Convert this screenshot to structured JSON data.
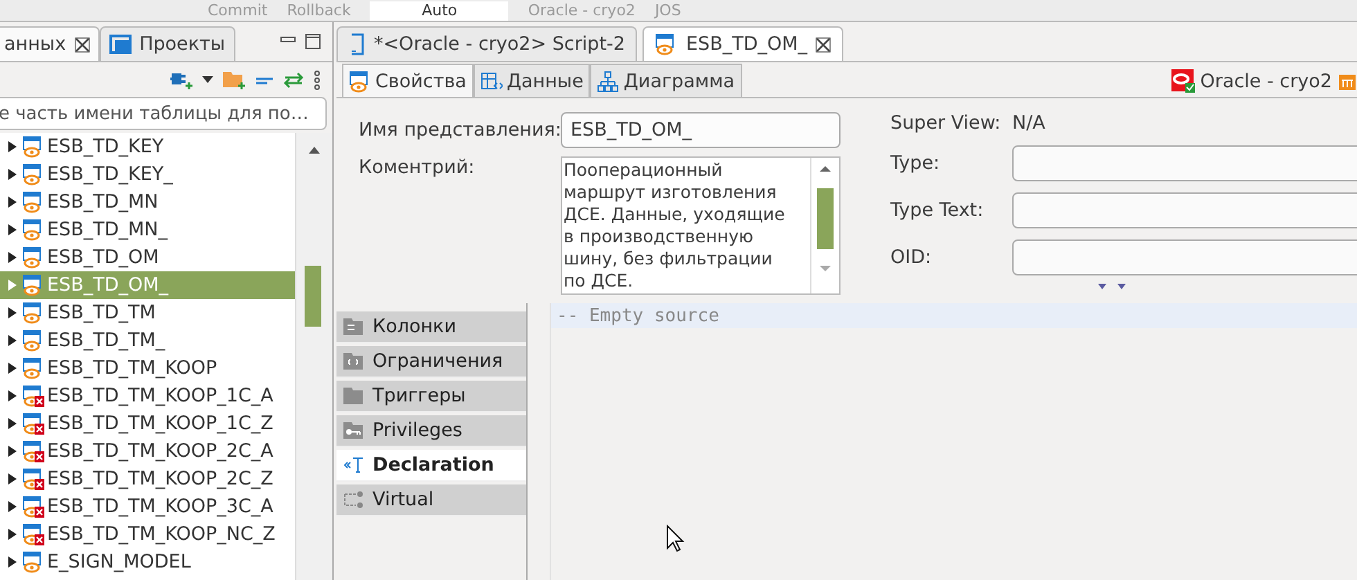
{
  "toolbar": {
    "items": [
      {
        "label": "Commit",
        "kind": "button"
      },
      {
        "label": "Rollback",
        "kind": "button"
      },
      {
        "label": "Auto",
        "kind": "combo"
      },
      {
        "label": "Oracle - cryo2",
        "kind": "button"
      },
      {
        "label": "JOS",
        "kind": "button"
      }
    ]
  },
  "left_panel": {
    "tabs": [
      {
        "label": "анных",
        "selected": true
      },
      {
        "label": "Проекты",
        "selected": false
      }
    ],
    "filter": {
      "placeholder": "е часть имени таблицы для по…"
    },
    "tree": [
      {
        "label": "ESB_TD_KEY",
        "kind": "view",
        "selected": false
      },
      {
        "label": "ESB_TD_KEY_",
        "kind": "view",
        "selected": false
      },
      {
        "label": "ESB_TD_MN",
        "kind": "view",
        "selected": false
      },
      {
        "label": "ESB_TD_MN_",
        "kind": "view",
        "selected": false
      },
      {
        "label": "ESB_TD_OM",
        "kind": "view",
        "selected": false
      },
      {
        "label": "ESB_TD_OM_",
        "kind": "view",
        "selected": true
      },
      {
        "label": "ESB_TD_TM",
        "kind": "view",
        "selected": false
      },
      {
        "label": "ESB_TD_TM_",
        "kind": "view",
        "selected": false
      },
      {
        "label": "ESB_TD_TM_KOOP",
        "kind": "view",
        "selected": false
      },
      {
        "label": "ESB_TD_TM_KOOP_1C_A",
        "kind": "invalid",
        "selected": false
      },
      {
        "label": "ESB_TD_TM_KOOP_1C_Z",
        "kind": "invalid",
        "selected": false
      },
      {
        "label": "ESB_TD_TM_KOOP_2C_A",
        "kind": "invalid",
        "selected": false
      },
      {
        "label": "ESB_TD_TM_KOOP_2C_Z",
        "kind": "invalid",
        "selected": false
      },
      {
        "label": "ESB_TD_TM_KOOP_3C_A",
        "kind": "invalid",
        "selected": false
      },
      {
        "label": "ESB_TD_TM_KOOP_NC_Z",
        "kind": "invalid",
        "selected": false
      },
      {
        "label": "E_SIGN_MODEL",
        "kind": "view",
        "selected": false
      }
    ]
  },
  "editor_tabs": [
    {
      "label": "*<Oracle - cryo2> Script-2",
      "kind": "script",
      "selected": false
    },
    {
      "label": "ESB_TD_OM_",
      "kind": "view",
      "selected": true
    }
  ],
  "sub_tabs": [
    {
      "label": "Свойства",
      "kind": "properties",
      "selected": true
    },
    {
      "label": "Данные",
      "kind": "data",
      "selected": false
    },
    {
      "label": "Диаграмма",
      "kind": "diagram",
      "selected": false
    }
  ],
  "connection": "Oracle - cryo2",
  "form": {
    "name_label": "Имя представления:",
    "name_value": "ESB_TD_OM_",
    "comment_label": "Коментрий:",
    "comment_value": "Пооперационный маршрут изготовления ДСЕ. Данные, уходящие в производственную шину, без фильтрации по ДСЕ.",
    "super_view_label": "Super View:",
    "super_view_value": "N/A",
    "fields": [
      {
        "label": "Type:"
      },
      {
        "label": "Type Text:"
      },
      {
        "label": "OID:"
      }
    ]
  },
  "sections": [
    {
      "label": "Колонки",
      "kind": "columns",
      "selected": false
    },
    {
      "label": "Ограничения",
      "kind": "constraints",
      "selected": false
    },
    {
      "label": "Триггеры",
      "kind": "triggers",
      "selected": false
    },
    {
      "label": "Privileges",
      "kind": "privileges",
      "selected": false
    },
    {
      "label": "Declaration",
      "kind": "declaration",
      "selected": true
    },
    {
      "label": "Virtual",
      "kind": "virtual",
      "selected": false
    }
  ],
  "source": {
    "lines": [
      "-- Empty source"
    ]
  }
}
